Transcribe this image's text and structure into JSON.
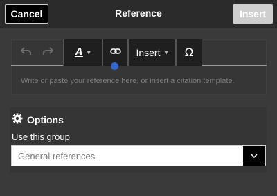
{
  "dialog": {
    "title": "Reference",
    "cancel_label": "Cancel",
    "insert_label": "Insert"
  },
  "toolbar": {
    "insert_menu_label": "Insert",
    "special_char_glyph": "Ω",
    "text_style_glyph": "A"
  },
  "editor": {
    "placeholder": "Write or paste your reference here, or insert a citation template."
  },
  "options": {
    "heading": "Options",
    "group_label": "Use this group",
    "group_select_value": "General references"
  }
}
